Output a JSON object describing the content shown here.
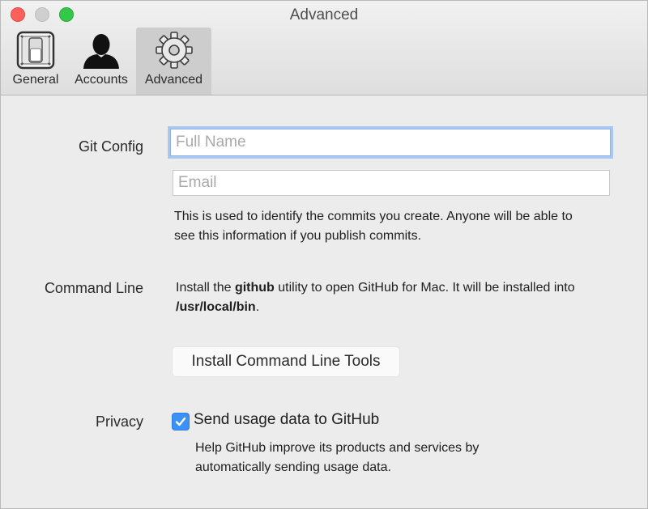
{
  "window": {
    "title": "Advanced"
  },
  "toolbar": {
    "tabs": [
      {
        "label": "General",
        "icon": "switch-icon",
        "selected": false
      },
      {
        "label": "Accounts",
        "icon": "person-icon",
        "selected": false
      },
      {
        "label": "Advanced",
        "icon": "gear-icon",
        "selected": true
      }
    ]
  },
  "git_config": {
    "label": "Git Config",
    "name_placeholder": "Full Name",
    "name_value": "",
    "email_placeholder": "Email",
    "email_value": "",
    "help": "This is used to identify the commits you create. Anyone will be able to see this information if you publish commits."
  },
  "command_line": {
    "label": "Command Line",
    "text_pre": "Install the ",
    "text_bold_1": "github",
    "text_mid": " utility to open GitHub for Mac. It will be installed into ",
    "text_bold_2": "/usr/local/bin",
    "text_post": ".",
    "button_label": "Install Command Line Tools"
  },
  "privacy": {
    "label": "Privacy",
    "checkbox_label": "Send usage data to GitHub",
    "checked": true,
    "help": "Help GitHub improve its products and services by automatically sending usage data."
  },
  "colors": {
    "accent": "#3b91f5",
    "focus_ring": "#a8c8f0",
    "close": "#fc605c",
    "zoom": "#34c84a"
  }
}
